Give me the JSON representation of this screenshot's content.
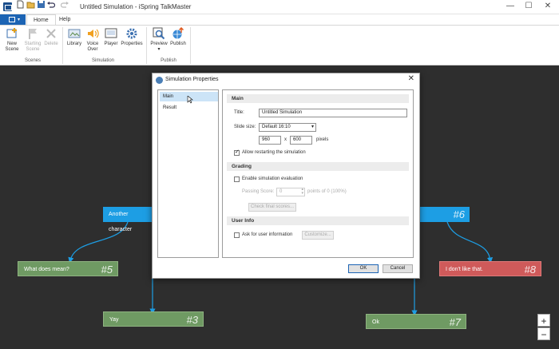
{
  "window": {
    "title": "Untitled Simulation - iSpring TalkMaster",
    "minimize": "—",
    "maximize": "☐",
    "close": "✕"
  },
  "quick_access": [
    "new-doc-icon",
    "open-folder-icon",
    "save-icon",
    "undo-icon",
    "redo-icon"
  ],
  "tabs": {
    "home": "Home",
    "help": "Help"
  },
  "ribbon": {
    "new_scene": "New Scene",
    "starting_scene": "Starting Scene",
    "delete": "Delete",
    "library": "Library",
    "voice_over": "Voice Over",
    "player": "Player",
    "properties": "Properties",
    "preview": "Preview",
    "publish": "Publish",
    "group_scenes": "Scenes",
    "group_simulation": "Simulation",
    "group_publish": "Publish"
  },
  "canvas": {
    "nodes": [
      {
        "label": "Another character",
        "num": ""
      },
      {
        "label": "What does mean?",
        "num": "#5"
      },
      {
        "label": "Yay",
        "num": "#3"
      },
      {
        "label": "",
        "num": "#6"
      },
      {
        "label": "I don't like that.",
        "num": "#8"
      },
      {
        "label": "Ok",
        "num": "#7"
      }
    ],
    "zoom_in": "+",
    "zoom_out": "−"
  },
  "dialog": {
    "title": "Simulation Properties",
    "close": "✕",
    "nav": [
      "Main",
      "Result"
    ],
    "main": {
      "header": "Main",
      "title_label": "Title:",
      "title_value": "Untitled Simulation",
      "slide_size_label": "Slide size:",
      "slide_size_value": "Default 16:10",
      "width": "960",
      "x": "x",
      "height": "600",
      "pixels": "pixels",
      "allow_restart": "Allow restarting the simulation",
      "allow_restart_checked": true
    },
    "grading": {
      "header": "Grading",
      "enable": "Enable simulation evaluation",
      "passing_label": "Passing Score:",
      "passing_value": "0",
      "points_of": "points of 0 (100%)",
      "check_button": "Check final scores..."
    },
    "user_info": {
      "header": "User Info",
      "ask": "Ask for user information",
      "customize": "Customize..."
    },
    "ok": "OK",
    "cancel": "Cancel"
  },
  "colors": {
    "canvas_bg": "#2e2e2e",
    "node_green": "#6f9a63",
    "node_blue": "#1d9ee4",
    "node_red": "#cf5a5a",
    "accent": "#1c64b4"
  }
}
